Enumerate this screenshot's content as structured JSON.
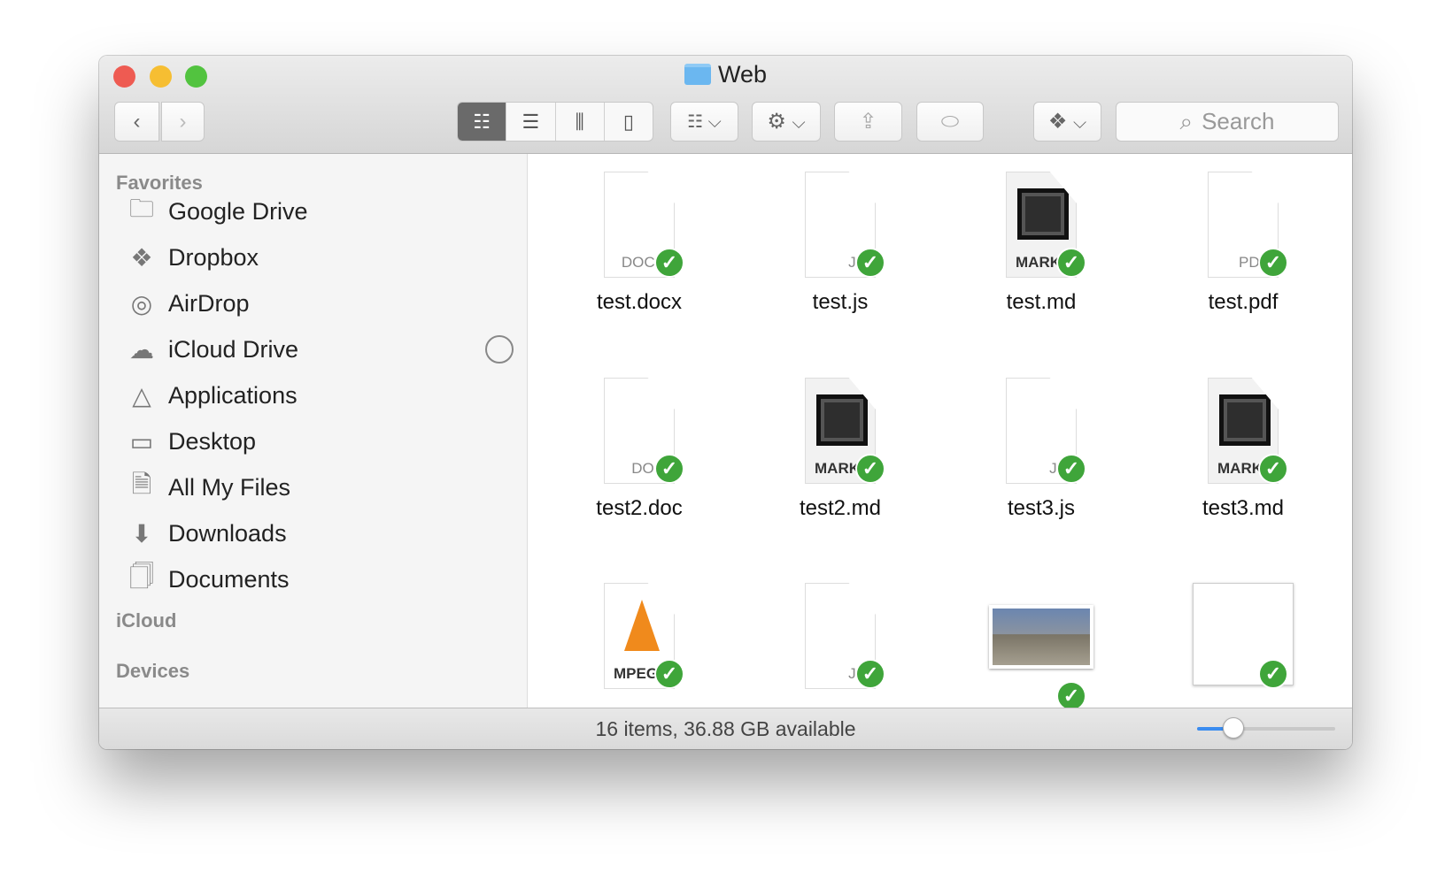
{
  "window": {
    "title": "Web",
    "colors": {
      "close": "#ee5b52",
      "minimize": "#f6be32",
      "zoom": "#52c33f",
      "accent": "#3a8cf0",
      "sync_check": "#3fa53a"
    }
  },
  "toolbar": {
    "back_icon": "chevron-left",
    "forward_icon": "chevron-right",
    "views": [
      "icon-view",
      "list-view",
      "column-view",
      "cover-flow-view"
    ],
    "active_view": "icon-view",
    "search_placeholder": "Search"
  },
  "sidebar": {
    "sections": {
      "favorites": "Favorites",
      "icloud": "iCloud",
      "devices": "Devices"
    },
    "items": [
      {
        "label": "Google Drive",
        "icon": "folder"
      },
      {
        "label": "Dropbox",
        "icon": "dropbox"
      },
      {
        "label": "AirDrop",
        "icon": "airdrop"
      },
      {
        "label": "iCloud Drive",
        "icon": "cloud"
      },
      {
        "label": "Applications",
        "icon": "applications"
      },
      {
        "label": "Desktop",
        "icon": "desktop"
      },
      {
        "label": "All My Files",
        "icon": "all-files"
      },
      {
        "label": "Downloads",
        "icon": "downloads"
      },
      {
        "label": "Documents",
        "icon": "documents"
      }
    ]
  },
  "files": [
    {
      "name": "test.docx",
      "badge": "DOCX",
      "kind": "doc"
    },
    {
      "name": "test.js",
      "badge": "JS",
      "kind": "doc"
    },
    {
      "name": "test.md",
      "badge": "MARK",
      "kind": "mark"
    },
    {
      "name": "test.pdf",
      "badge": "PDF",
      "kind": "doc"
    },
    {
      "name": "test2.doc",
      "badge": "DOC",
      "kind": "doc"
    },
    {
      "name": "test2.md",
      "badge": "MARK",
      "kind": "mark"
    },
    {
      "name": "test3.js",
      "badge": "JS",
      "kind": "doc"
    },
    {
      "name": "test3.md",
      "badge": "MARK",
      "kind": "mark"
    },
    {
      "name": "",
      "badge": "MPEG",
      "kind": "vlc"
    },
    {
      "name": "",
      "badge": "JS",
      "kind": "doc"
    },
    {
      "name": "",
      "badge": "",
      "kind": "image"
    },
    {
      "name": "",
      "badge": "",
      "kind": "blank"
    }
  ],
  "status": {
    "text": "16 items, 36.88 GB available",
    "icon_size_fraction": 0.26
  }
}
